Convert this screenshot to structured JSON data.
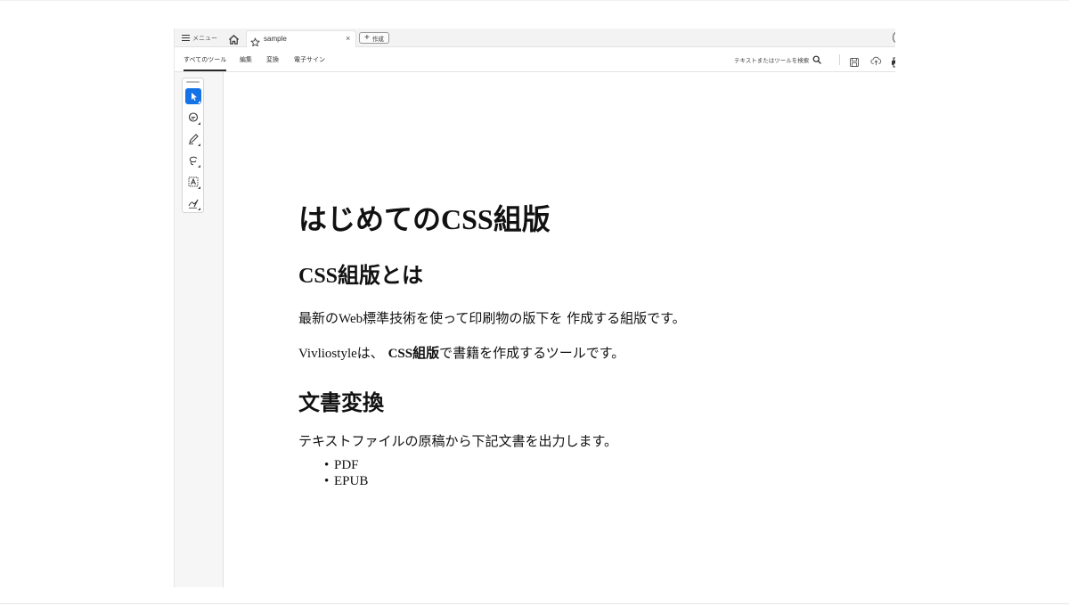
{
  "tabbar": {
    "menu_label": "メニュー",
    "tab_title": "sample",
    "tab_close": "×",
    "new_tab_plus": "+",
    "new_tab_label": "作成"
  },
  "toolbar": {
    "nav": [
      "すべてのツール",
      "編集",
      "変換",
      "電子サイン"
    ],
    "search_placeholder": "テキストまたはツールを検索"
  },
  "tools": [
    {
      "name": "select-tool",
      "active": true
    },
    {
      "name": "comment-tool",
      "active": false
    },
    {
      "name": "draw-tool",
      "active": false
    },
    {
      "name": "lasso-tool",
      "active": false
    },
    {
      "name": "text-select-tool",
      "active": false
    },
    {
      "name": "signature-tool",
      "active": false
    }
  ],
  "document": {
    "title_pre": "はじめての",
    "title_css": "CSS",
    "title_post": "組版",
    "h2_css_pre": "CSS",
    "h2_css_post": "組版とは",
    "p1_pre": "最新の",
    "p1_web": "Web",
    "p1_post": "標準技術を使って印刷物の版下を 作成する組版です。",
    "p2_viv": "Vivliostyle",
    "p2_ha": "は、",
    "p2_bold_css": "CSS",
    "p2_bold_kumi": "組版",
    "p2_post": "で書籍を作成するツールです。",
    "h2_convert": "文書変換",
    "p3": "テキストファイルの原稿から下記文書を出力します。",
    "list": [
      "PDF",
      "EPUB"
    ]
  },
  "colors": {
    "accent": "#1473e6",
    "text": "#111111",
    "chrome_bg": "#f3f3f3"
  }
}
